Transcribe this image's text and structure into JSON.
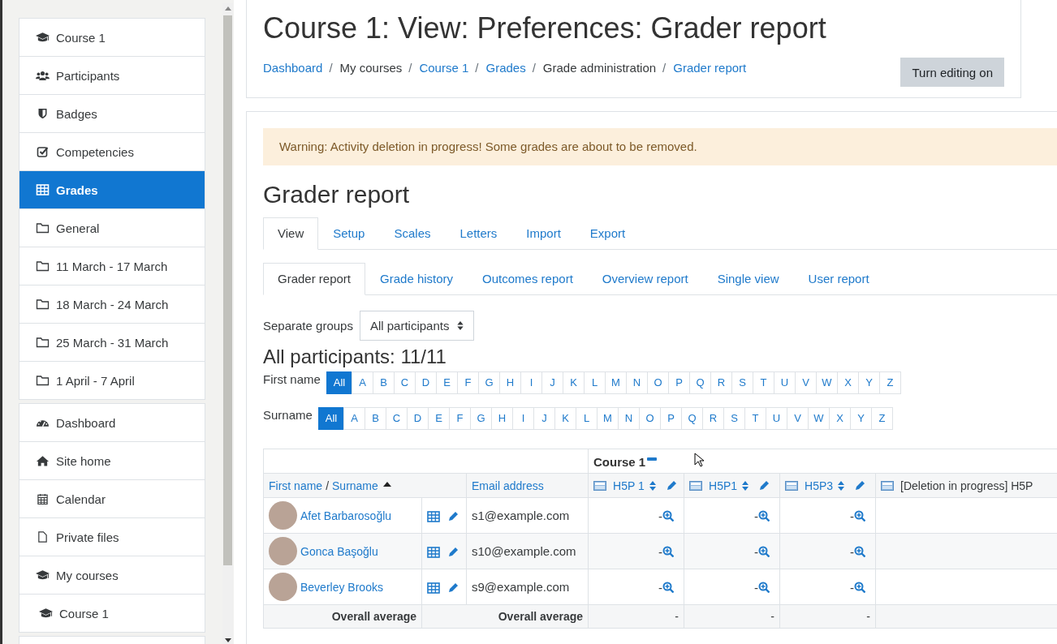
{
  "sidebar": {
    "groups": [
      {
        "items": [
          {
            "label": "Course 1",
            "kind": "course",
            "selected": false
          },
          {
            "label": "Participants",
            "kind": "people",
            "selected": false
          },
          {
            "label": "Badges",
            "kind": "shield",
            "selected": false
          },
          {
            "label": "Competencies",
            "kind": "checkbox",
            "selected": false
          },
          {
            "label": "Grades",
            "kind": "table",
            "selected": true
          },
          {
            "label": "General",
            "kind": "folder",
            "selected": false
          },
          {
            "label": "11 March - 17 March",
            "kind": "folder",
            "selected": false
          },
          {
            "label": "18 March - 24 March",
            "kind": "folder",
            "selected": false
          },
          {
            "label": "25 March - 31 March",
            "kind": "folder",
            "selected": false
          },
          {
            "label": "1 April - 7 April",
            "kind": "folder",
            "selected": false
          }
        ]
      },
      {
        "items": [
          {
            "label": "Dashboard",
            "kind": "gauge",
            "selected": false
          },
          {
            "label": "Site home",
            "kind": "home",
            "selected": false
          },
          {
            "label": "Calendar",
            "kind": "calendar",
            "selected": false
          },
          {
            "label": "Private files",
            "kind": "file",
            "selected": false
          },
          {
            "label": "My courses",
            "kind": "course",
            "selected": false
          },
          {
            "label": "Course 1",
            "kind": "course-sub",
            "selected": false
          }
        ]
      }
    ]
  },
  "header": {
    "title": "Course 1: View: Preferences: Grader report",
    "breadcrumb": [
      {
        "label": "Dashboard",
        "link": true
      },
      {
        "separator": "/",
        "label": "My courses",
        "link": false
      },
      {
        "separator": "/",
        "label": "Course 1",
        "link": true
      },
      {
        "separator": "/",
        "label": "Grades",
        "link": true
      },
      {
        "separator": "/",
        "label": "Grade administration",
        "link": false
      },
      {
        "separator": "/",
        "label": "Grader report",
        "link": true
      }
    ],
    "button": "Turn editing on"
  },
  "alert": "Warning: Activity deletion in progress! Some grades are about to be removed.",
  "heading": "Grader report",
  "tabs": [
    {
      "label": "View",
      "selected": true
    },
    {
      "label": "Setup",
      "selected": false
    },
    {
      "label": "Scales",
      "selected": false
    },
    {
      "label": "Letters",
      "selected": false
    },
    {
      "label": "Import",
      "selected": false
    },
    {
      "label": "Export",
      "selected": false
    }
  ],
  "subtabs": [
    {
      "label": "Grader report",
      "selected": true
    },
    {
      "label": "Grade history",
      "selected": false
    },
    {
      "label": "Outcomes report",
      "selected": false
    },
    {
      "label": "Overview report",
      "selected": false
    },
    {
      "label": "Single view",
      "selected": false
    },
    {
      "label": "User report",
      "selected": false
    }
  ],
  "groups_select": {
    "label": "Separate groups",
    "value": "All participants"
  },
  "participants_heading": "All participants: 11/11",
  "filters": [
    {
      "label": "First name",
      "letters": [
        {
          "text": "All",
          "selected": true
        },
        {
          "text": "A",
          "selected": false
        },
        {
          "text": "B",
          "selected": false
        },
        {
          "text": "C",
          "selected": false
        },
        {
          "text": "D",
          "selected": false
        },
        {
          "text": "E",
          "selected": false
        },
        {
          "text": "F",
          "selected": false
        },
        {
          "text": "G",
          "selected": false
        },
        {
          "text": "H",
          "selected": false
        },
        {
          "text": "I",
          "selected": false
        },
        {
          "text": "J",
          "selected": false
        },
        {
          "text": "K",
          "selected": false
        },
        {
          "text": "L",
          "selected": false
        },
        {
          "text": "M",
          "selected": false
        },
        {
          "text": "N",
          "selected": false
        },
        {
          "text": "O",
          "selected": false
        },
        {
          "text": "P",
          "selected": false
        },
        {
          "text": "Q",
          "selected": false
        },
        {
          "text": "R",
          "selected": false
        },
        {
          "text": "S",
          "selected": false
        },
        {
          "text": "T",
          "selected": false
        },
        {
          "text": "U",
          "selected": false
        },
        {
          "text": "V",
          "selected": false
        },
        {
          "text": "W",
          "selected": false
        },
        {
          "text": "X",
          "selected": false
        },
        {
          "text": "Y",
          "selected": false
        },
        {
          "text": "Z",
          "selected": false
        }
      ]
    },
    {
      "label": "Surname",
      "letters": [
        {
          "text": "All",
          "selected": true
        },
        {
          "text": "A",
          "selected": false
        },
        {
          "text": "B",
          "selected": false
        },
        {
          "text": "C",
          "selected": false
        },
        {
          "text": "D",
          "selected": false
        },
        {
          "text": "E",
          "selected": false
        },
        {
          "text": "F",
          "selected": false
        },
        {
          "text": "G",
          "selected": false
        },
        {
          "text": "H",
          "selected": false
        },
        {
          "text": "I",
          "selected": false
        },
        {
          "text": "J",
          "selected": false
        },
        {
          "text": "K",
          "selected": false
        },
        {
          "text": "L",
          "selected": false
        },
        {
          "text": "M",
          "selected": false
        },
        {
          "text": "N",
          "selected": false
        },
        {
          "text": "O",
          "selected": false
        },
        {
          "text": "P",
          "selected": false
        },
        {
          "text": "Q",
          "selected": false
        },
        {
          "text": "R",
          "selected": false
        },
        {
          "text": "S",
          "selected": false
        },
        {
          "text": "T",
          "selected": false
        },
        {
          "text": "U",
          "selected": false
        },
        {
          "text": "V",
          "selected": false
        },
        {
          "text": "W",
          "selected": false
        },
        {
          "text": "X",
          "selected": false
        },
        {
          "text": "Y",
          "selected": false
        },
        {
          "text": "Z",
          "selected": false
        }
      ]
    }
  ],
  "table": {
    "category": "Course 1",
    "name_header": {
      "first": "First name",
      "separator": "/",
      "last": "Surname",
      "sort_ascending": true
    },
    "email_header": "Email address",
    "grade_columns": [
      {
        "label": "H5P 1",
        "kind": "normal"
      },
      {
        "label": "H5P1",
        "kind": "normal"
      },
      {
        "label": "H5P3",
        "kind": "normal"
      },
      {
        "label": "[Deletion in progress] H5P",
        "kind": "deleting"
      }
    ],
    "rows": [
      {
        "name": "Afet Barbarosoğlu",
        "email": "s1@example.com",
        "grades": [
          "-",
          "-",
          "-"
        ]
      },
      {
        "name": "Gonca Başoğlu",
        "email": "s10@example.com",
        "grades": [
          "-",
          "-",
          "-"
        ]
      },
      {
        "name": "Beverley Brooks",
        "email": "s9@example.com",
        "grades": [
          "-",
          "-",
          "-"
        ]
      }
    ],
    "average_row": {
      "label": "Overall average",
      "email_label": "Overall average",
      "grades": [
        "-",
        "-",
        "-"
      ]
    }
  }
}
